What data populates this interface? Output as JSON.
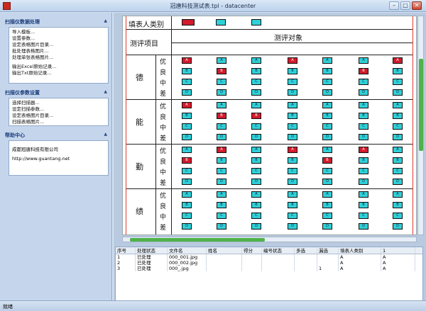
{
  "window": {
    "title": "冠唐科技测试表.tpl - datacenter",
    "minimize": "–",
    "maximize": "□",
    "close": "✕"
  },
  "sidebar": {
    "panels": [
      {
        "title": "扫描仪数据处理",
        "items": [
          "导入模板...",
          "设置参数...",
          "设定表格图片目录...",
          "批处理表格图片...",
          "处理单张表格图片...",
          "",
          "输出Excel原始记录...",
          "输出Txt原始记录..."
        ]
      },
      {
        "title": "扫描仪参数设置",
        "items": [
          "选择扫描器...",
          "设定扫描参数...",
          "设定表格图片目录...",
          "扫描表格图片..."
        ]
      },
      {
        "title": "帮助中心",
        "items": [
          "成都冠唐科技有限公司",
          "",
          "http://www.guantang.net"
        ]
      }
    ]
  },
  "form": {
    "label_fill_type": "填表人类别",
    "label_item": "测评项目",
    "label_target": "测评对象",
    "grade_labels": [
      "优",
      "良",
      "中",
      "差"
    ],
    "groups": [
      "德",
      "能",
      "勤",
      "绩"
    ],
    "option_labels": [
      "A",
      "B",
      "C",
      "D"
    ]
  },
  "grid": {
    "columns": [
      "序号",
      "处理状态",
      "文件名",
      "姓名",
      "得分",
      "编号状态",
      "多选",
      "漏选",
      "填表人类别",
      "1"
    ],
    "rows": [
      [
        "1",
        "已处理",
        "000_001.jpg",
        "",
        "",
        "",
        "",
        "",
        "A",
        "A"
      ],
      [
        "2",
        "已处理",
        "000_002.jpg",
        "",
        "",
        "",
        "",
        "",
        "A",
        "A"
      ],
      [
        "3",
        "已处理",
        "000_.jpg",
        "",
        "",
        "",
        "",
        "1",
        "A",
        "A"
      ]
    ]
  },
  "status": {
    "text": "就绪"
  }
}
